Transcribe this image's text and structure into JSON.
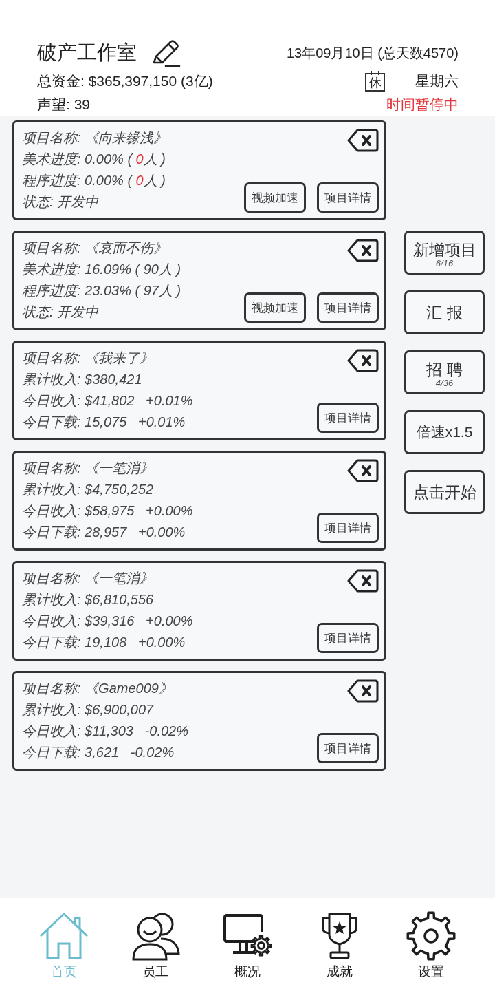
{
  "header": {
    "studio_name": "破产工作室",
    "date": "13年09月10日 (总天数4570)",
    "funds": "总资金: $365,397,150 (3亿)",
    "day_badge": "休",
    "weekday": "星期六",
    "reputation": "声望: 39",
    "time_status": "时间暂停中"
  },
  "projects": [
    {
      "name": "项目名称: 《向来缘浅》",
      "lines": [
        {
          "kind": "progress",
          "prefix": "美术进度: 0.00% ( ",
          "staff": "0",
          "suffix": "人 )",
          "alert": true
        },
        {
          "kind": "progress",
          "prefix": "程序进度: 0.00% ( ",
          "staff": "0",
          "suffix": "人 )",
          "alert": true
        },
        {
          "kind": "text",
          "text": "状态: 开发中"
        }
      ],
      "buttons": [
        "视频加速",
        "项目详情"
      ]
    },
    {
      "name": "项目名称: 《哀而不伤》",
      "lines": [
        {
          "kind": "progress",
          "prefix": "美术进度: 16.09% ( ",
          "staff": "90",
          "suffix": "人 )",
          "alert": false
        },
        {
          "kind": "progress",
          "prefix": "程序进度: 23.03% ( ",
          "staff": "97",
          "suffix": "人 )",
          "alert": false
        },
        {
          "kind": "text",
          "text": "状态: 开发中"
        }
      ],
      "buttons": [
        "视频加速",
        "项目详情"
      ]
    },
    {
      "name": "项目名称: 《我来了》",
      "lines": [
        {
          "kind": "text",
          "text": "累计收入: $380,421"
        },
        {
          "kind": "text",
          "text": "今日收入: $41,802   +0.01%"
        },
        {
          "kind": "text",
          "text": "今日下载: 15,075   +0.01%"
        }
      ],
      "buttons": [
        "项目详情"
      ]
    },
    {
      "name": "项目名称: 《一笔消》",
      "lines": [
        {
          "kind": "text",
          "text": "累计收入: $4,750,252"
        },
        {
          "kind": "text",
          "text": "今日收入: $58,975   +0.00%"
        },
        {
          "kind": "text",
          "text": "今日下载: 28,957   +0.00%"
        }
      ],
      "buttons": [
        "项目详情"
      ]
    },
    {
      "name": "项目名称: 《一笔消》",
      "lines": [
        {
          "kind": "text",
          "text": "累计收入: $6,810,556"
        },
        {
          "kind": "text",
          "text": "今日收入: $39,316   +0.00%"
        },
        {
          "kind": "text",
          "text": "今日下载: 19,108   +0.00%"
        }
      ],
      "buttons": [
        "项目详情"
      ]
    },
    {
      "name": "项目名称: 《Game009》",
      "lines": [
        {
          "kind": "text",
          "text": "累计收入: $6,900,007"
        },
        {
          "kind": "text",
          "text": "今日收入: $11,303   -0.02%"
        },
        {
          "kind": "text",
          "text": "今日下载: 3,621   -0.02%"
        }
      ],
      "buttons": [
        "项目详情"
      ]
    }
  ],
  "side_buttons": [
    {
      "label": "新增项目",
      "count": "6/16"
    },
    {
      "label": "汇 报"
    },
    {
      "label": "招 聘",
      "count": "4/36"
    },
    {
      "label": "倍速x1.5"
    },
    {
      "label": "点击开始"
    }
  ],
  "nav": [
    {
      "label": "首页",
      "selected": true
    },
    {
      "label": "员工",
      "selected": false
    },
    {
      "label": "概况",
      "selected": false
    },
    {
      "label": "成就",
      "selected": false
    },
    {
      "label": "设置",
      "selected": false
    }
  ]
}
